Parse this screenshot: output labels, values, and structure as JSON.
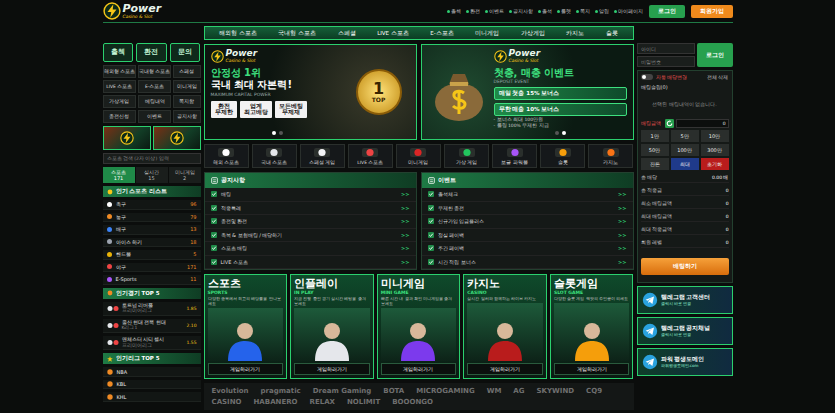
{
  "header": {
    "logo": {
      "name": "Power",
      "tagline": "Casino & Slot"
    },
    "links": [
      "출첵",
      "환전",
      "이벤트",
      "공지사항",
      "출석",
      "룰렛",
      "쪽지",
      "알림",
      "마이페이지"
    ],
    "login_button": "로그인",
    "join_button": "회원가입"
  },
  "nav": [
    "해외형 스포츠",
    "국내형 스포츠",
    "스페셜",
    "LIVE 스포츠",
    "E-스포츠",
    "미니게임",
    "가상게임",
    "카지노",
    "슬롯"
  ],
  "left": {
    "quick": [
      "출첵",
      "환전",
      "문의"
    ],
    "menu": [
      "해외형 스포츠",
      "국내형 스포츠",
      "스페셜",
      "LIVE 스포츠",
      "E-스포츠",
      "미니게임",
      "가상게임",
      "베팅내역",
      "쪽지함",
      "충전신청",
      "이벤트",
      "공지사항"
    ],
    "search": {
      "placeholder": "스포츠 검색 (2자 이상) 입력"
    },
    "tabs": [
      {
        "label": "스포츠",
        "count": "171",
        "selected": true
      },
      {
        "label": "실시간",
        "count": "15",
        "selected": false
      },
      {
        "label": "미니게임",
        "count": "2",
        "selected": false
      }
    ],
    "popular": {
      "title": "인기 스포츠 리스트",
      "items": [
        {
          "name": "축구",
          "count": "96",
          "color": "#ffffff"
        },
        {
          "name": "농구",
          "count": "79",
          "color": "#f08a24"
        },
        {
          "name": "배구",
          "count": "13",
          "color": "#3b82f6"
        },
        {
          "name": "아이스 하키",
          "count": "18",
          "color": "#9ca3af"
        },
        {
          "name": "핸드볼",
          "count": "5",
          "color": "#eab308"
        },
        {
          "name": "야구",
          "count": "171",
          "color": "#ef4444"
        },
        {
          "name": "E-Sports",
          "count": "11",
          "color": "#a855f7"
        }
      ]
    },
    "matches": {
      "title": "인기경기 TOP 5",
      "items": [
        {
          "teams": "토트넘 리버풀",
          "league": "프리미어리그",
          "odds": "1.85"
        },
        {
          "teams": "울산 현대 전북 현대",
          "league": "K리그1",
          "odds": "2.10"
        },
        {
          "teams": "맨체스터 시티 첼시",
          "league": "프리미어리그",
          "odds": "1.55"
        }
      ]
    },
    "leagues": {
      "title": "인기리그 TOP 5",
      "items": [
        "NBA",
        "KBL",
        "KHL"
      ]
    }
  },
  "center": {
    "banners": [
      {
        "accent": "안정성 1위",
        "headline": "국내 최대 자본력!",
        "sub": "MAXIMUM CAPITAL POWER",
        "boxes": [
          {
            "top": "환전",
            "bottom": "무제한"
          },
          {
            "top": "업계",
            "bottom": "최고배당"
          },
          {
            "top": "모든베팅",
            "bottom": "무제재"
          }
        ],
        "badge": "1",
        "badge_sub": "TOP",
        "dots": [
          {
            "selected": true
          },
          {
            "selected": false
          }
        ]
      },
      {
        "accent": "첫충, 매충 이벤트",
        "sub": "DEPOSIT EVENT",
        "pills": [
          "매일 첫충 15% 보너스",
          "무한 매충 10% 보너스"
        ],
        "notes": [
          "- 보너스 최대 100만원",
          "- 롤링 100% 무제한 지급"
        ],
        "dots": [
          {
            "selected": false
          },
          {
            "selected": true
          }
        ]
      }
    ],
    "games": [
      {
        "label": "해외 스포츠",
        "color": "#ffffff"
      },
      {
        "label": "국내 스포츠",
        "color": "#e5e7eb"
      },
      {
        "label": "스페셜 게임",
        "color": "#f3f4f6"
      },
      {
        "label": "LIVE 스포츠",
        "color": "#ef4444"
      },
      {
        "label": "미니게임",
        "color": "#dc2626"
      },
      {
        "label": "가상 게임",
        "color": "#22c55e"
      },
      {
        "label": "보글 파워볼",
        "color": "#a855f7"
      },
      {
        "label": "슬롯",
        "color": "#f59e0b"
      },
      {
        "label": "카지노",
        "color": "#f97316"
      }
    ],
    "boards": [
      {
        "title": "공지사항",
        "arrow": ">>",
        "items": [
          "배팅",
          "적중특례",
          "충전및 환전",
          "축복 & 보험배팅 / 배당하기",
          "스포츠 배팅",
          "LIVE 스포츠"
        ]
      },
      {
        "title": "이벤트",
        "arrow": ">>",
        "items": [
          "출석체크",
          "무제한 충전",
          "신규가입 입금플러스",
          "정실 페이백",
          "주간 페이백",
          "시간 적립 보너스"
        ]
      }
    ],
    "cards": [
      {
        "title": "스포츠",
        "sub": "SPORTS",
        "desc": "다양한 종목에서 최고의 배당률을 만나보세요",
        "button": "게임하러가기"
      },
      {
        "title": "인플레이",
        "sub": "IN PLAY",
        "desc": "지금 진행 중인 경기 실시간 베팅을 즐겨보세요",
        "button": "게임하러가기"
      },
      {
        "title": "미니게임",
        "sub": "MINI GAME",
        "desc": "빠른 시간 내 결과 확인 미니게임을 즐겨보세요",
        "button": "게임하러가기"
      },
      {
        "title": "카지노",
        "sub": "CASINO",
        "desc": "실시간 딜러와 함께하는 라이브 카지노",
        "button": "게임하러가기"
      },
      {
        "title": "슬롯게임",
        "sub": "SLOT GAME",
        "desc": "다양한 슬롯 게임 잭팟의 주인공이 되세요",
        "button": "게임하러가기"
      }
    ],
    "providers": [
      "Evolution",
      "pragmatic",
      "Dream Gaming",
      "BOTA",
      "MICROGAMING",
      "WM",
      "AG",
      "SKYWIND",
      "CQ9",
      "CASINO",
      "HABANERO",
      "RELAX",
      "NOLIMIT",
      "BOOONGO"
    ]
  },
  "right": {
    "login": {
      "id": "아이디",
      "pw": "비밀번호",
      "button": "로그인"
    },
    "betslip": {
      "auto": {
        "label": "자동 배당변경",
        "on": false
      },
      "clear": "전체 삭제",
      "title": "배팅슬립(0)",
      "empty": "선택된 배팅내역이 없습니다.",
      "amount_label": "배팅금액",
      "amount": "0",
      "quick": [
        {
          "label": "1만",
          "kind": "normal"
        },
        {
          "label": "5만",
          "kind": "normal"
        },
        {
          "label": "10만",
          "kind": "normal"
        },
        {
          "label": "50만",
          "kind": "normal"
        },
        {
          "label": "100만",
          "kind": "normal"
        },
        {
          "label": "300만",
          "kind": "normal"
        },
        {
          "label": "잔돈",
          "kind": "normal"
        },
        {
          "label": "최대",
          "kind": "blue"
        },
        {
          "label": "초기화",
          "kind": "red"
        }
      ],
      "rows": [
        {
          "label": "총 배당",
          "value": "0.00 배"
        },
        {
          "label": "총 적중금",
          "value": "0"
        },
        {
          "label": "최소 배팅금액",
          "value": "0"
        },
        {
          "label": "최대 배팅금액",
          "value": "0"
        },
        {
          "label": "최대 적중금액",
          "value": "0"
        },
        {
          "label": "회원 레벨",
          "value": "0"
        }
      ],
      "button": "배팅하기"
    },
    "promos": [
      {
        "title": "텔레그램 고객센터",
        "sub": "클릭시 바로 연결"
      },
      {
        "title": "텔레그램 공지채널",
        "sub": "클릭시 바로 연결"
      },
      {
        "title": "파워 평생도메인",
        "sub": "파워평생도메인.com"
      }
    ]
  }
}
